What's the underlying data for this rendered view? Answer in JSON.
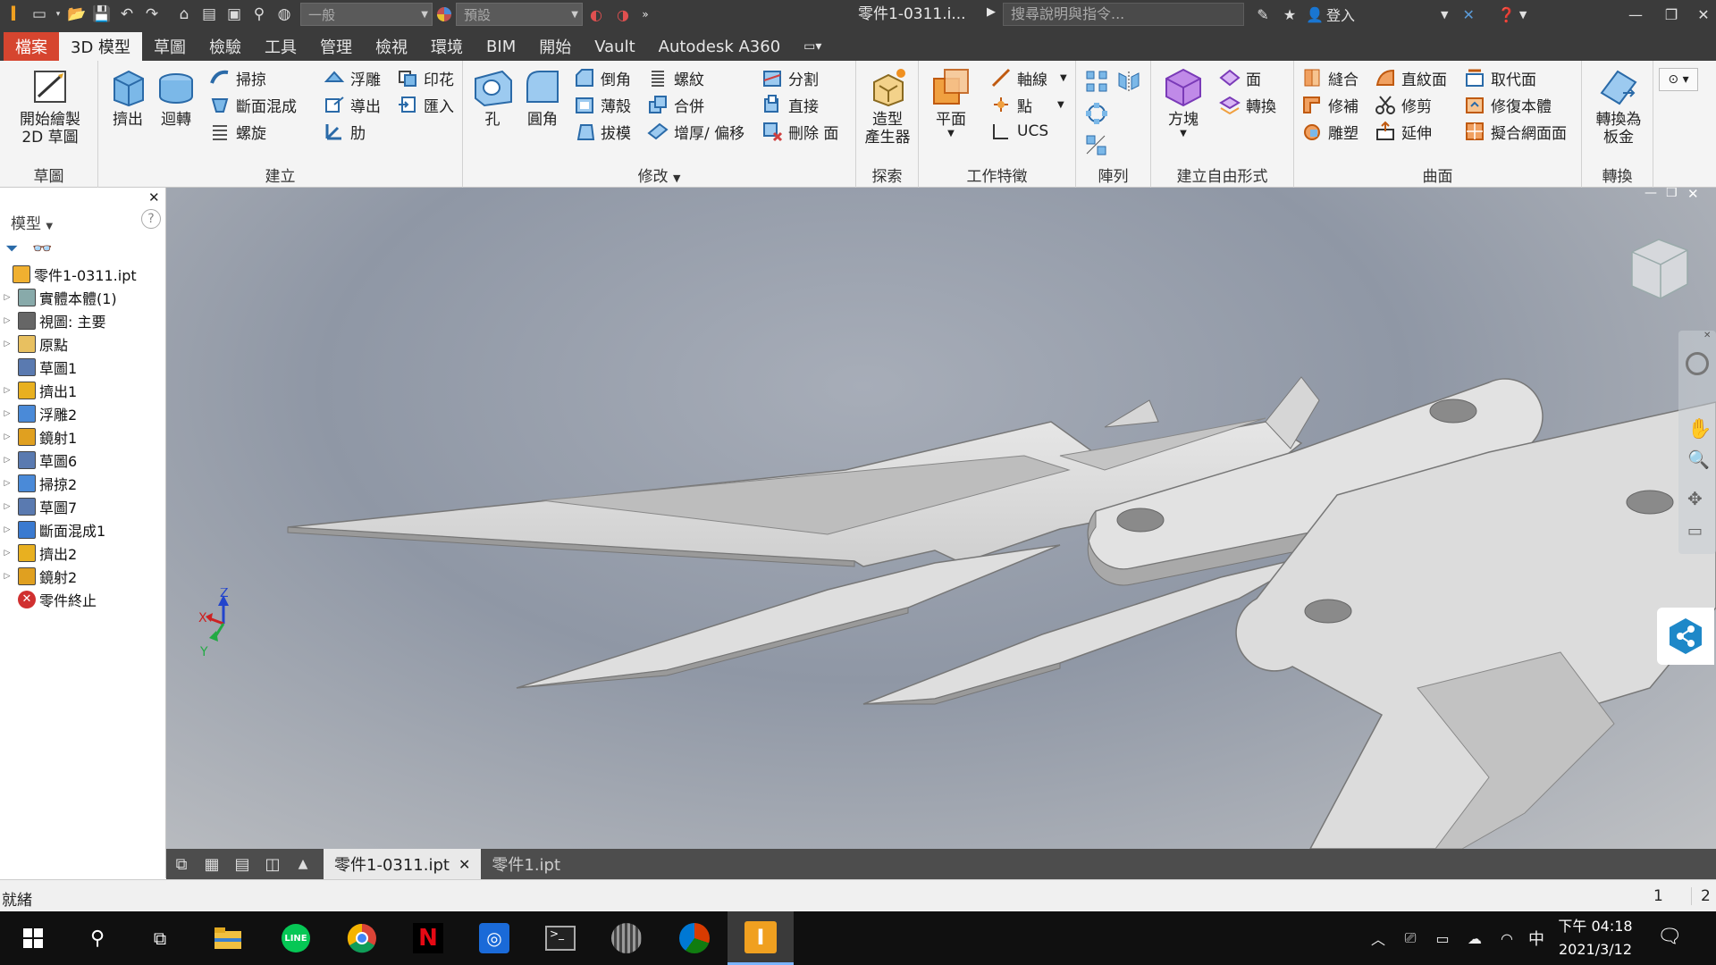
{
  "titlebar": {
    "style_combo": "一般",
    "appearance_combo": "預設",
    "document_title": "零件1-0311.i...",
    "search_placeholder": "搜尋說明與指令...",
    "sign_in": "登入"
  },
  "tabs": [
    "檔案",
    "3D 模型",
    "草圖",
    "檢驗",
    "工具",
    "管理",
    "檢視",
    "環境",
    "BIM",
    "開始",
    "Vault",
    "Autodesk A360"
  ],
  "active_tab": "3D 模型",
  "ribbon": {
    "sketch": {
      "title": "草圖",
      "start_sketch": "開始繪製",
      "start_sketch2": "2D 草圖"
    },
    "create": {
      "title": "建立",
      "extrude": "擠出",
      "revolve": "迴轉",
      "sweep": "掃掠",
      "loft": "斷面混成",
      "coil": "螺旋",
      "emboss": "浮雕",
      "derive": "導出",
      "rib": "肋",
      "decal": "印花",
      "import": "匯入"
    },
    "modify": {
      "title": "修改",
      "hole": "孔",
      "fillet": "圓角",
      "chamfer": "倒角",
      "shell": "薄殼",
      "draft": "拔模",
      "thread": "螺紋",
      "combine": "合併",
      "thicken": "增厚/ 偏移",
      "split": "分割",
      "direct": "直接",
      "delete_face": "刪除 面"
    },
    "explore": {
      "title": "探索",
      "shape_generator": "造型",
      "shape_generator2": "產生器"
    },
    "work_features": {
      "title": "工作特徵",
      "plane": "平面",
      "axis": "軸線",
      "point": "點",
      "ucs": "UCS"
    },
    "pattern": {
      "title": "陣列"
    },
    "freeform": {
      "title": "建立自由形式",
      "box": "方塊",
      "face": "面",
      "convert": "轉換"
    },
    "surface": {
      "title": "曲面",
      "stitch": "縫合",
      "patch": "修補",
      "sculpt": "雕塑",
      "ruled": "直紋面",
      "trim": "修剪",
      "extend": "延伸",
      "replace": "取代面",
      "repair": "修復本體",
      "fit_mesh": "擬合網面面"
    },
    "convert": {
      "title": "轉換",
      "to_sheet_metal": "轉換為",
      "to_sheet_metal2": "板金"
    }
  },
  "browser": {
    "title": "模型",
    "items": [
      {
        "label": "零件1-0311.ipt",
        "expandable": false,
        "icon": "part-icon"
      },
      {
        "label": "實體本體(1)",
        "expandable": true,
        "icon": "solid-bodies-icon"
      },
      {
        "label": "視圖: 主要",
        "expandable": true,
        "icon": "view-rep-icon"
      },
      {
        "label": "原點",
        "expandable": true,
        "icon": "folder-icon"
      },
      {
        "label": "草圖1",
        "expandable": false,
        "icon": "sketch-icon"
      },
      {
        "label": "擠出1",
        "expandable": true,
        "icon": "extrude-icon"
      },
      {
        "label": "浮雕2",
        "expandable": true,
        "icon": "emboss-icon"
      },
      {
        "label": "鏡射1",
        "expandable": true,
        "icon": "mirror-icon"
      },
      {
        "label": "草圖6",
        "expandable": true,
        "icon": "sketch-icon"
      },
      {
        "label": "掃掠2",
        "expandable": true,
        "icon": "sweep-icon"
      },
      {
        "label": "草圖7",
        "expandable": true,
        "icon": "sketch-icon"
      },
      {
        "label": "斷面混成1",
        "expandable": true,
        "icon": "loft-icon"
      },
      {
        "label": "擠出2",
        "expandable": true,
        "icon": "extrude-icon"
      },
      {
        "label": "鏡射2",
        "expandable": true,
        "icon": "mirror-icon"
      },
      {
        "label": "零件終止",
        "expandable": false,
        "icon": "end-of-part-icon"
      }
    ]
  },
  "doc_tabs": [
    "零件1-0311.ipt",
    "零件1.ipt"
  ],
  "status": {
    "text": "就緒",
    "num1": "1",
    "num2": "2"
  },
  "triad": {
    "x": "X",
    "y": "Y",
    "z": "Z"
  },
  "taskbar": {
    "time_line1": "下午 04:18",
    "date": "2021/3/12",
    "ime": "中"
  },
  "colors": {
    "file_tab": "#d6452f",
    "ribbon_bg": "#f4f4f4",
    "titlebar": "#3b3b3b",
    "taskbar": "#101010"
  }
}
